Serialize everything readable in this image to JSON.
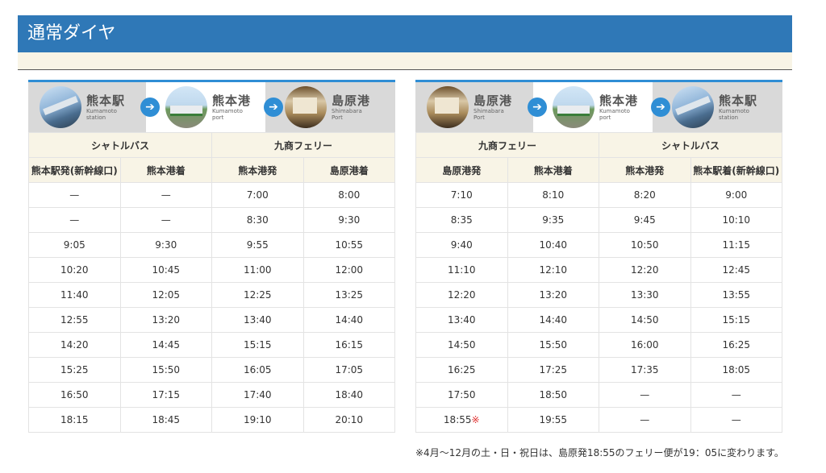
{
  "title": "通常ダイヤ",
  "left": {
    "stops": [
      {
        "name": "熊本駅",
        "sub1": "Kumamoto",
        "sub2": "station",
        "photo": "kumamoto-station-photo"
      },
      {
        "name": "熊本港",
        "sub1": "Kumamoto",
        "sub2": "port",
        "photo": "kumamoto-port-photo"
      },
      {
        "name": "島原港",
        "sub1": "Shimabara",
        "sub2": "Port",
        "photo": "shimabara-port-photo"
      }
    ],
    "groups": [
      "シャトルバス",
      "九商フェリー"
    ],
    "columns": [
      "熊本駅発(新幹線口)",
      "熊本港着",
      "熊本港発",
      "島原港着"
    ],
    "rows": [
      [
        "—",
        "—",
        "7:00",
        "8:00"
      ],
      [
        "—",
        "—",
        "8:30",
        "9:30"
      ],
      [
        "9:05",
        "9:30",
        "9:55",
        "10:55"
      ],
      [
        "10:20",
        "10:45",
        "11:00",
        "12:00"
      ],
      [
        "11:40",
        "12:05",
        "12:25",
        "13:25"
      ],
      [
        "12:55",
        "13:20",
        "13:40",
        "14:40"
      ],
      [
        "14:20",
        "14:45",
        "15:15",
        "16:15"
      ],
      [
        "15:25",
        "15:50",
        "16:05",
        "17:05"
      ],
      [
        "16:50",
        "17:15",
        "17:40",
        "18:40"
      ],
      [
        "18:15",
        "18:45",
        "19:10",
        "20:10"
      ]
    ]
  },
  "right": {
    "stops": [
      {
        "name": "島原港",
        "sub1": "Shimabara",
        "sub2": "Port",
        "photo": "shimabara-port-photo"
      },
      {
        "name": "熊本港",
        "sub1": "Kumamoto",
        "sub2": "port",
        "photo": "kumamoto-port-photo"
      },
      {
        "name": "熊本駅",
        "sub1": "Kumamoto",
        "sub2": "station",
        "photo": "kumamoto-station-photo"
      }
    ],
    "groups": [
      "九商フェリー",
      "シャトルバス"
    ],
    "columns": [
      "島原港発",
      "熊本港着",
      "熊本港発",
      "熊本駅着(新幹線口)"
    ],
    "rows": [
      [
        "7:10",
        "8:10",
        "8:20",
        "9:00"
      ],
      [
        "8:35",
        "9:35",
        "9:45",
        "10:10"
      ],
      [
        "9:40",
        "10:40",
        "10:50",
        "11:15"
      ],
      [
        "11:10",
        "12:10",
        "12:20",
        "12:45"
      ],
      [
        "12:20",
        "13:20",
        "13:30",
        "13:55"
      ],
      [
        "13:40",
        "14:40",
        "14:50",
        "15:15"
      ],
      [
        "14:50",
        "15:50",
        "16:00",
        "16:25"
      ],
      [
        "16:25",
        "17:25",
        "17:35",
        "18:05"
      ],
      [
        "17:50",
        "18:50",
        "—",
        "—"
      ],
      [
        "18:55",
        "19:55",
        "—",
        "—"
      ]
    ],
    "mark": "※"
  },
  "note": "※4月～12月の土・日・祝日は、島原発18:55のフェリー便が19：05に変わります。",
  "colors": {
    "title_bg": "#2f78b7",
    "header_bg": "#f8f4e6",
    "arrow": "#2f8ed5",
    "mark": "#e0302f"
  }
}
